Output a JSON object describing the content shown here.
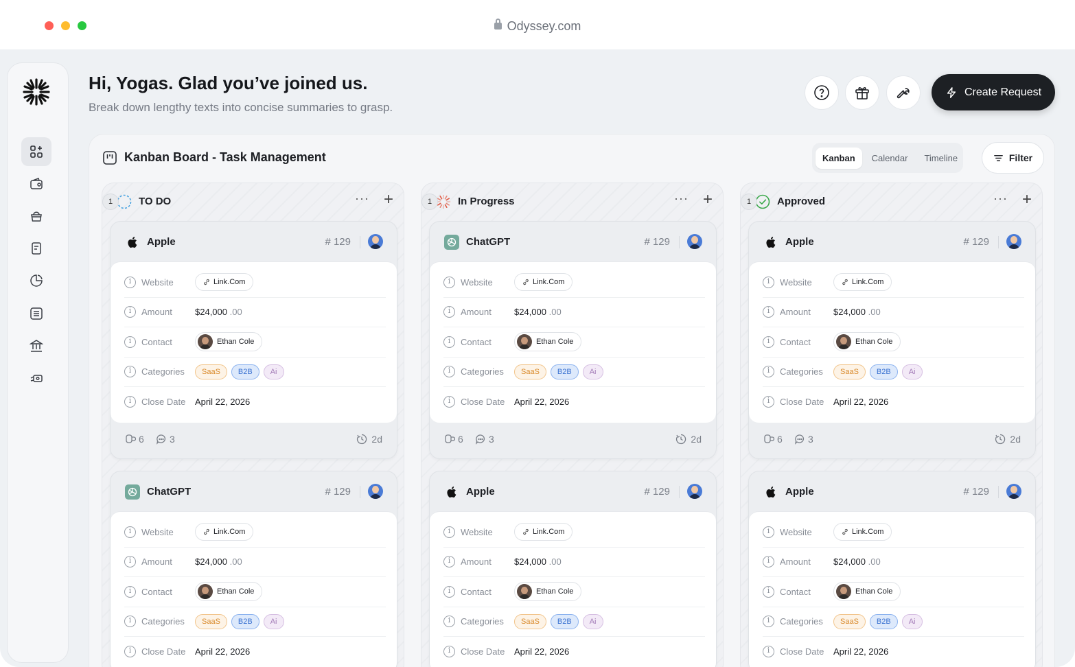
{
  "browser": {
    "url": "Odyssey.com"
  },
  "header": {
    "greeting": "Hi, Yogas. Glad you’ve joined us.",
    "subtitle": "Break down lengthy texts into concise summaries to grasp.",
    "create_label": "Create Request"
  },
  "board": {
    "title": "Kanban Board - Task Management",
    "views": [
      "Kanban",
      "Calendar",
      "Timeline"
    ],
    "active_view": "Kanban",
    "filter_label": "Filter"
  },
  "field_labels": {
    "website": "Website",
    "amount": "Amount",
    "contact": "Contact",
    "categories": "Categories",
    "close_date": "Close Date"
  },
  "columns": [
    {
      "name": "TO DO",
      "count": "1",
      "status": "todo",
      "cards": [
        {
          "brand": "Apple",
          "number": "# 129",
          "website": "Link.Com",
          "amount": "$24,000",
          "cents": ".00",
          "contact": "Ethan Cole",
          "tags": [
            "SaaS",
            "B2B",
            "Ai"
          ],
          "close_date": "April 22, 2026",
          "attachments": "6",
          "comments": "3",
          "time": "2d"
        },
        {
          "brand": "ChatGPT",
          "number": "# 129",
          "website": "Link.Com",
          "amount": "$24,000",
          "cents": ".00",
          "contact": "Ethan Cole",
          "tags": [
            "SaaS",
            "B2B",
            "Ai"
          ],
          "close_date": "April 22, 2026"
        }
      ]
    },
    {
      "name": "In Progress",
      "count": "1",
      "status": "progress",
      "cards": [
        {
          "brand": "ChatGPT",
          "number": "# 129",
          "website": "Link.Com",
          "amount": "$24,000",
          "cents": ".00",
          "contact": "Ethan Cole",
          "tags": [
            "SaaS",
            "B2B",
            "Ai"
          ],
          "close_date": "April 22, 2026",
          "attachments": "6",
          "comments": "3",
          "time": "2d"
        },
        {
          "brand": "Apple",
          "number": "# 129",
          "website": "Link.Com",
          "amount": "$24,000",
          "cents": ".00",
          "contact": "Ethan Cole",
          "tags": [
            "SaaS",
            "B2B",
            "Ai"
          ],
          "close_date": "April 22, 2026"
        }
      ]
    },
    {
      "name": "Approved",
      "count": "1",
      "status": "approved",
      "cards": [
        {
          "brand": "Apple",
          "number": "# 129",
          "website": "Link.Com",
          "amount": "$24,000",
          "cents": ".00",
          "contact": "Ethan Cole",
          "tags": [
            "SaaS",
            "B2B",
            "Ai"
          ],
          "close_date": "April 22, 2026",
          "attachments": "6",
          "comments": "3",
          "time": "2d"
        },
        {
          "brand": "Apple",
          "number": "# 129",
          "website": "Link.Com",
          "amount": "$24,000",
          "cents": ".00",
          "contact": "Ethan Cole",
          "tags": [
            "SaaS",
            "B2B",
            "Ai"
          ],
          "close_date": "April 22, 2026"
        }
      ]
    }
  ],
  "colors": {
    "accent_dark": "#1d2024",
    "saas": "#d98a2b",
    "b2b": "#3a72d1",
    "ai": "#a27bb7",
    "approved": "#3aa84a",
    "progress": "#e0523a",
    "todo": "#4aa3e0"
  }
}
